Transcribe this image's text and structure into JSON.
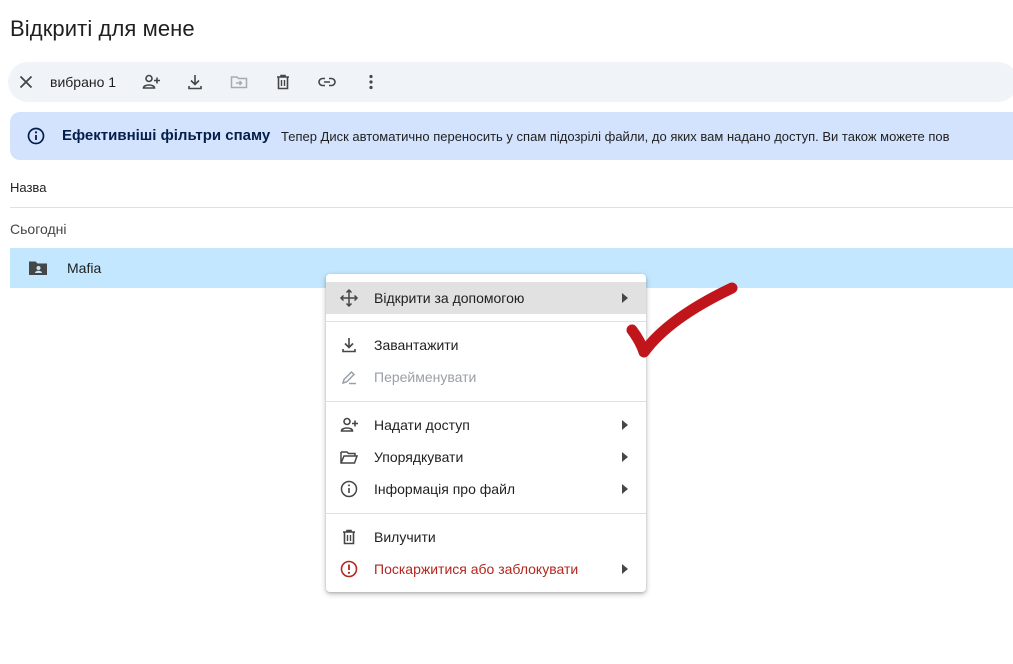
{
  "page": {
    "title": "Відкриті для мене"
  },
  "selection_bar": {
    "count_label": "вибрано 1"
  },
  "banner": {
    "title": "Ефективніші фільтри спаму",
    "text": "Тепер Диск автоматично переносить у спам підозрілі файли, до яких вам надано доступ. Ви також можете пов"
  },
  "list": {
    "column_name": "Назва",
    "group_label": "Сьогодні",
    "rows": [
      {
        "name": "Mafia"
      }
    ]
  },
  "context_menu": {
    "items": [
      {
        "label": "Відкрити за допомогою",
        "icon": "move-arrows-icon",
        "submenu": true,
        "highlighted": true
      },
      {
        "label": "Завантажити",
        "icon": "download-icon",
        "submenu": false
      },
      {
        "label": "Перейменувати",
        "icon": "edit-pencil-icon",
        "submenu": false,
        "disabled": true
      },
      {
        "label": "Надати доступ",
        "icon": "person-add-icon",
        "submenu": true
      },
      {
        "label": "Упорядкувати",
        "icon": "folder-open-icon",
        "submenu": true
      },
      {
        "label": "Інформація про файл",
        "icon": "info-icon",
        "submenu": true
      },
      {
        "label": "Вилучити",
        "icon": "trash-icon",
        "submenu": false
      },
      {
        "label": "Поскаржитися або заблокувати",
        "icon": "report-icon",
        "submenu": true,
        "danger": true
      }
    ]
  },
  "colors": {
    "selected_row": "#c2e7ff",
    "banner_bg": "#d3e3fd",
    "danger": "#b3261e",
    "checkmark": "#c0151a"
  }
}
